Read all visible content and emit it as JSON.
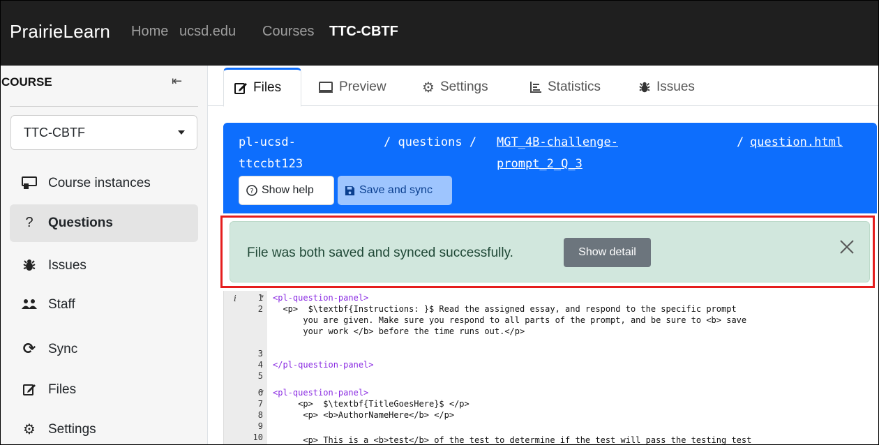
{
  "navbar": {
    "brand": "PrairieLearn",
    "links": [
      "Home",
      "ucsd.edu",
      "Courses",
      "TTC-CBTF"
    ]
  },
  "sidebar": {
    "heading": "COURSE",
    "course_select": "TTC-CBTF",
    "items": [
      {
        "label": "Course instances",
        "icon": "monitor-icon"
      },
      {
        "label": "Questions",
        "icon": "question-icon"
      },
      {
        "label": "Issues",
        "icon": "bug-icon"
      },
      {
        "label": "Staff",
        "icon": "people-icon"
      },
      {
        "label": "Sync",
        "icon": "sync-icon"
      },
      {
        "label": "Files",
        "icon": "edit-icon"
      },
      {
        "label": "Settings",
        "icon": "gear-icon"
      }
    ]
  },
  "tabs": [
    {
      "label": "Files",
      "icon": "edit-icon"
    },
    {
      "label": "Preview",
      "icon": "monitor-icon"
    },
    {
      "label": "Settings",
      "icon": "gear-icon"
    },
    {
      "label": "Statistics",
      "icon": "chart-icon"
    },
    {
      "label": "Issues",
      "icon": "bug-icon"
    }
  ],
  "editor_header": {
    "course_part1": "pl-ucsd-",
    "course_part2": "ttccbt123",
    "sep1": "/ questions /",
    "question_part1": "MGT_4B-challenge-",
    "question_part2": "prompt_2_Q_3",
    "sep2": "/",
    "file": "question.html",
    "help_label": "Show help",
    "save_label": "Save and sync",
    "color": "#0d6efd"
  },
  "alert": {
    "message": "File was both saved and synced successfully.",
    "detail_label": "Show detail",
    "color": "#d1e7dd"
  },
  "code": {
    "info": "i",
    "line_numbers": [
      "1",
      "2",
      "",
      "",
      "3",
      "4",
      "5",
      "6",
      "7",
      "8",
      "9",
      "10"
    ],
    "lines": [
      "<pl-question-panel>",
      "  <p>  $\\textbf{Instructions: }$ Read the assigned essay, and respond to the specific prompt",
      "      you are given. Make sure you respond to all parts of the prompt, and be sure to <b> save",
      "      your work </b> before the time runs out.</p>",
      "",
      "</pl-question-panel>",
      "",
      "<pl-question-panel>",
      "     <p>  $\\textbf{TitleGoesHere}$ </p>",
      "      <p> <b>AuthorNameHere</b> </p>",
      "",
      "      <p> This is a <b>test</b> of the test to determine if the test will pass the testing test"
    ]
  }
}
